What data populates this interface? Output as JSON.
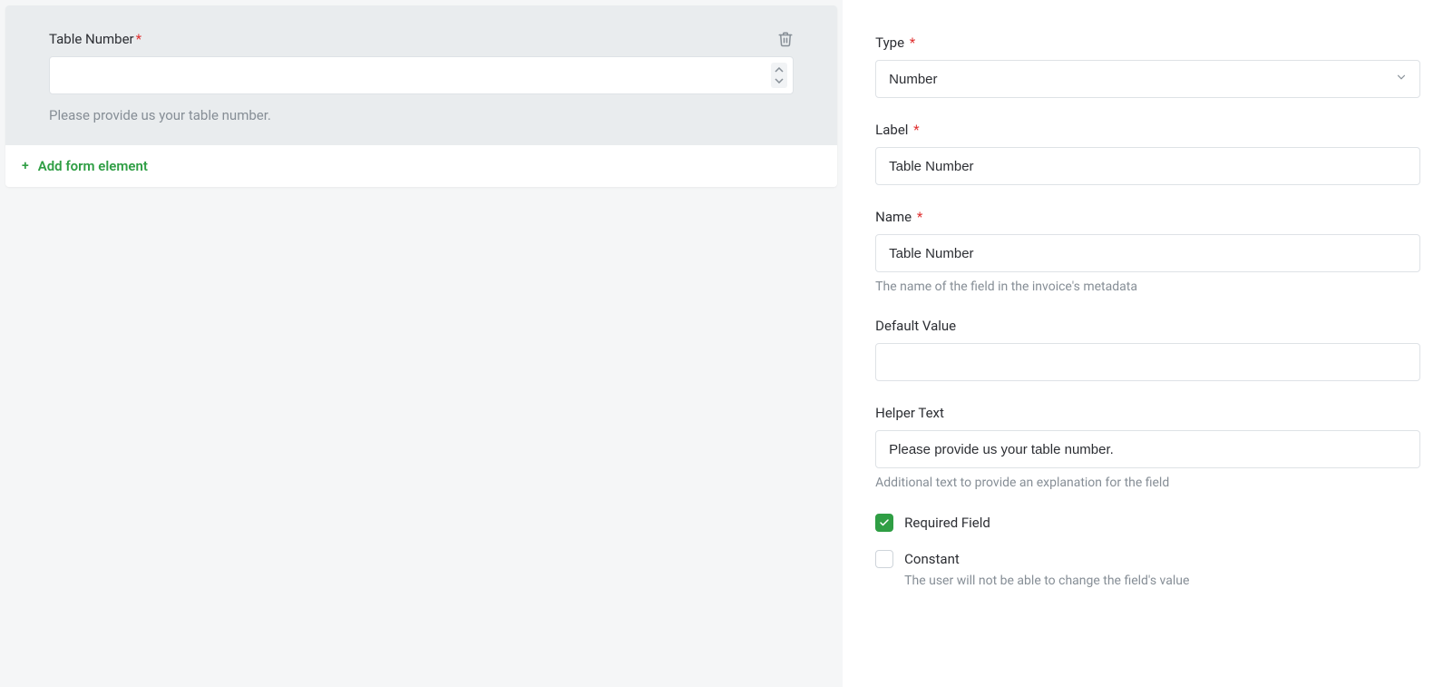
{
  "preview": {
    "field_label": "Table Number",
    "helper_text": "Please provide us your table number."
  },
  "add_element": "Add form element",
  "sidebar": {
    "type": {
      "label": "Type",
      "value": "Number"
    },
    "label": {
      "label": "Label",
      "value": "Table Number"
    },
    "name": {
      "label": "Name",
      "value": "Table Number",
      "hint": "The name of the field in the invoice's metadata"
    },
    "default_value": {
      "label": "Default Value",
      "value": ""
    },
    "helper_text": {
      "label": "Helper Text",
      "value": "Please provide us your table number.",
      "hint": "Additional text to provide an explanation for the field"
    },
    "required_field": {
      "label": "Required Field",
      "checked": true
    },
    "constant": {
      "label": "Constant",
      "checked": false,
      "hint": "The user will not be able to change the field's value"
    }
  }
}
